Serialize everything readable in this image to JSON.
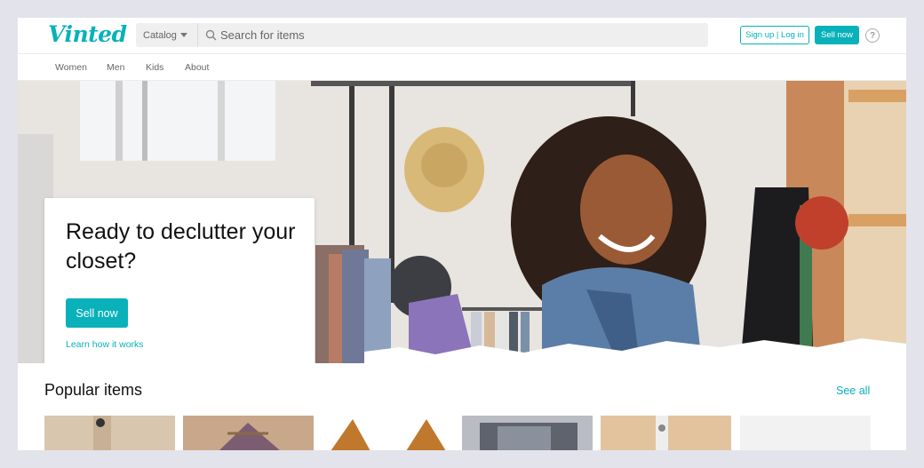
{
  "header": {
    "logo": "Vinted",
    "catalog_label": "Catalog",
    "search_placeholder": "Search for items",
    "signup_label": "Sign up | Log in",
    "sell_label": "Sell now",
    "help_glyph": "?"
  },
  "nav": {
    "items": [
      "Women",
      "Men",
      "Kids",
      "About"
    ]
  },
  "hero": {
    "title": "Ready to declutter your closet?",
    "sell_label": "Sell now",
    "learn_label": "Learn how it works"
  },
  "popular": {
    "title": "Popular items",
    "see_all": "See all"
  },
  "colors": {
    "accent": "#09b1ba",
    "text": "#111111",
    "muted": "#666666",
    "backdrop": "#e3e3ec"
  }
}
